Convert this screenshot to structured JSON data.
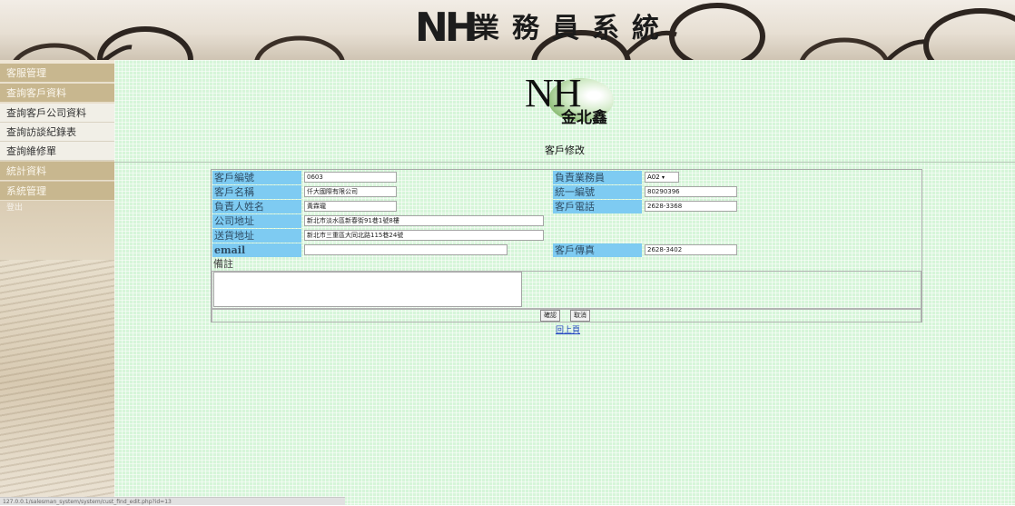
{
  "header": {
    "logo_text": "NH",
    "title": "業務員系統"
  },
  "sidebar": {
    "items": [
      {
        "label": "客服管理",
        "style": "dark"
      },
      {
        "label": "查詢客戶資料",
        "style": "dark"
      },
      {
        "label": "查詢客戶公司資料",
        "style": "light"
      },
      {
        "label": "查詢訪談紀錄表",
        "style": "light"
      },
      {
        "label": "查詢維修單",
        "style": "light"
      },
      {
        "label": "統計資料",
        "style": "dark"
      },
      {
        "label": "系統管理",
        "style": "dark"
      },
      {
        "label": "登出",
        "style": "logout"
      }
    ]
  },
  "logo": {
    "letters": "NH",
    "company": "金北鑫"
  },
  "page_title": "客戶修改",
  "form": {
    "customer_id": {
      "label": "客戶編號",
      "value": "0603"
    },
    "salesperson": {
      "label": "負責業務員",
      "value": "A02"
    },
    "customer_name": {
      "label": "客戶名稱",
      "value": "仟大國際有限公司"
    },
    "tax_id": {
      "label": "統一編號",
      "value": "80290396"
    },
    "contact_name": {
      "label": "負責人姓名",
      "value": "黃霖瓏"
    },
    "phone": {
      "label": "客戶電話",
      "value": "2628-3368"
    },
    "company_address": {
      "label": "公司地址",
      "value": "新北市淡水區新春街91巷1號8樓"
    },
    "shipping_address": {
      "label": "送貨地址",
      "value": "新北市三重區大同北路115巷24號"
    },
    "email": {
      "label": "email",
      "value": ""
    },
    "fax": {
      "label": "客戶傳真",
      "value": "2628-3402"
    },
    "remarks": {
      "label": "備註",
      "value": ""
    },
    "confirm_label": "確認",
    "cancel_label": "取消"
  },
  "back_link": "回上頁",
  "status_url": "127.0.0.1/salesman_system/system/cust_find_edit.php?id=13",
  "colors": {
    "label_bg": "#7ecbf2",
    "main_bg": "#d6f5d9",
    "menu_dark": "#c8b78f"
  }
}
